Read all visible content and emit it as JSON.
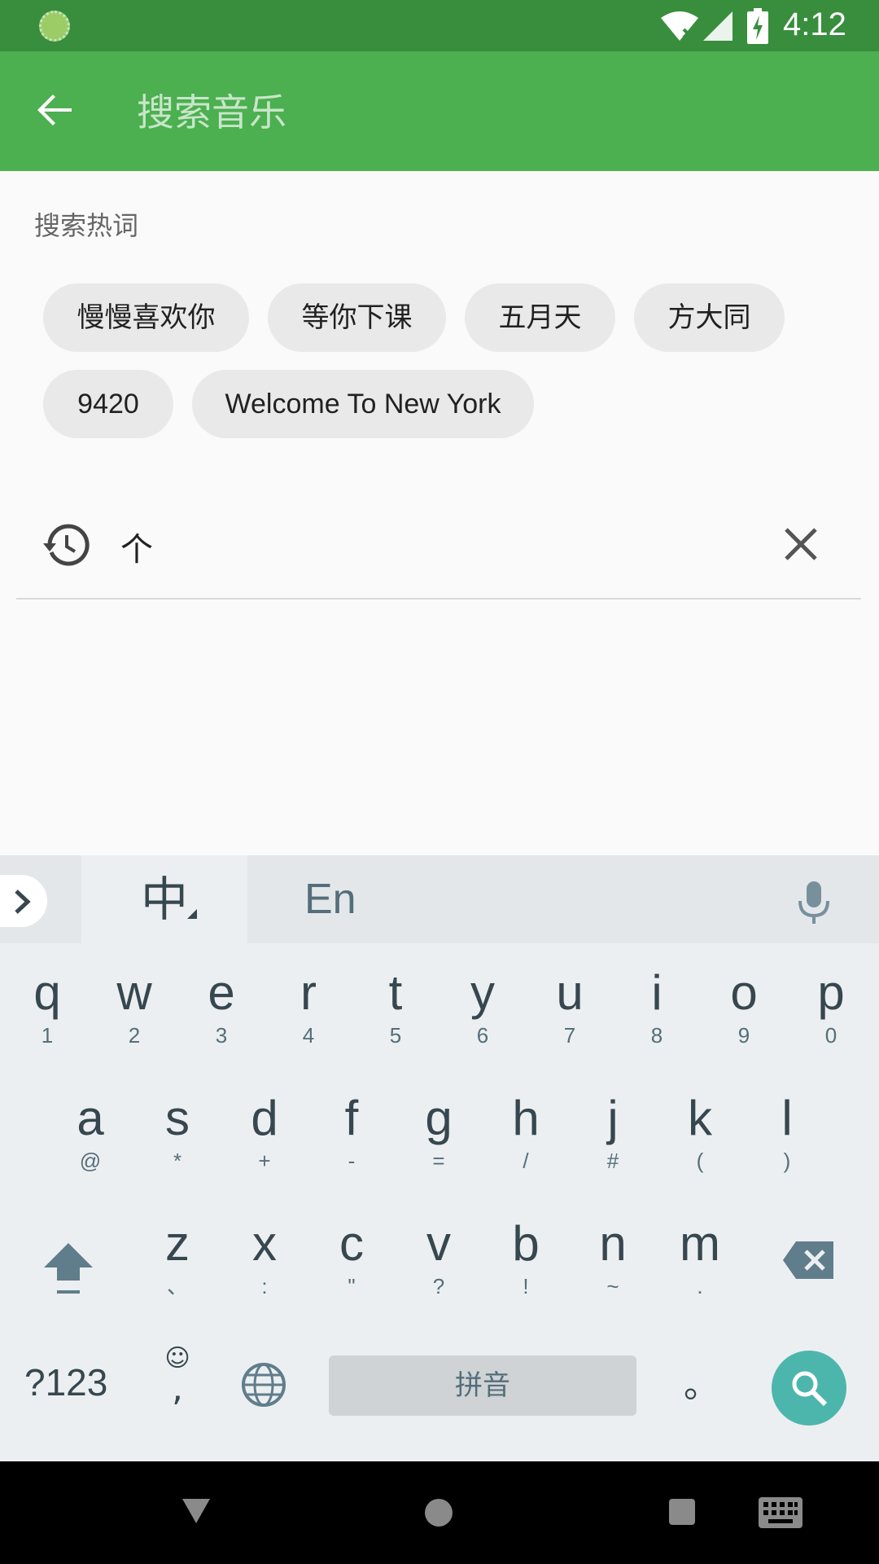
{
  "status_bar": {
    "time": "4:12"
  },
  "app_bar": {
    "search_placeholder": "搜索音乐"
  },
  "hot_words": {
    "title": "搜索热词",
    "chips": [
      "慢慢喜欢你",
      "等你下课",
      "五月天",
      "方大同",
      "9420",
      "Welcome To New York"
    ]
  },
  "history": {
    "items": [
      {
        "text": "个"
      }
    ]
  },
  "keyboard": {
    "zh_label": "中",
    "en_label": "En",
    "row1": [
      {
        "key": "q",
        "sub": "1"
      },
      {
        "key": "w",
        "sub": "2"
      },
      {
        "key": "e",
        "sub": "3"
      },
      {
        "key": "r",
        "sub": "4"
      },
      {
        "key": "t",
        "sub": "5"
      },
      {
        "key": "y",
        "sub": "6"
      },
      {
        "key": "u",
        "sub": "7"
      },
      {
        "key": "i",
        "sub": "8"
      },
      {
        "key": "o",
        "sub": "9"
      },
      {
        "key": "p",
        "sub": "0"
      }
    ],
    "row2": [
      {
        "key": "a",
        "sub": "@"
      },
      {
        "key": "s",
        "sub": "*"
      },
      {
        "key": "d",
        "sub": "+"
      },
      {
        "key": "f",
        "sub": "-"
      },
      {
        "key": "g",
        "sub": "="
      },
      {
        "key": "h",
        "sub": "/"
      },
      {
        "key": "j",
        "sub": "#"
      },
      {
        "key": "k",
        "sub": "("
      },
      {
        "key": "l",
        "sub": ")"
      }
    ],
    "row3": [
      {
        "key": "z",
        "sub": "、"
      },
      {
        "key": "x",
        "sub": ":"
      },
      {
        "key": "c",
        "sub": "\""
      },
      {
        "key": "v",
        "sub": "?"
      },
      {
        "key": "b",
        "sub": "!"
      },
      {
        "key": "n",
        "sub": "~"
      },
      {
        "key": "m",
        "sub": "."
      }
    ],
    "symbols_label": "?123",
    "emoji_label": "☺",
    "comma_label": ",",
    "space_label": "拼音",
    "period_label": "。"
  },
  "colors": {
    "status_bar": "#388e3c",
    "app_bar": "#4caf50",
    "search_key": "#4db6ac"
  }
}
